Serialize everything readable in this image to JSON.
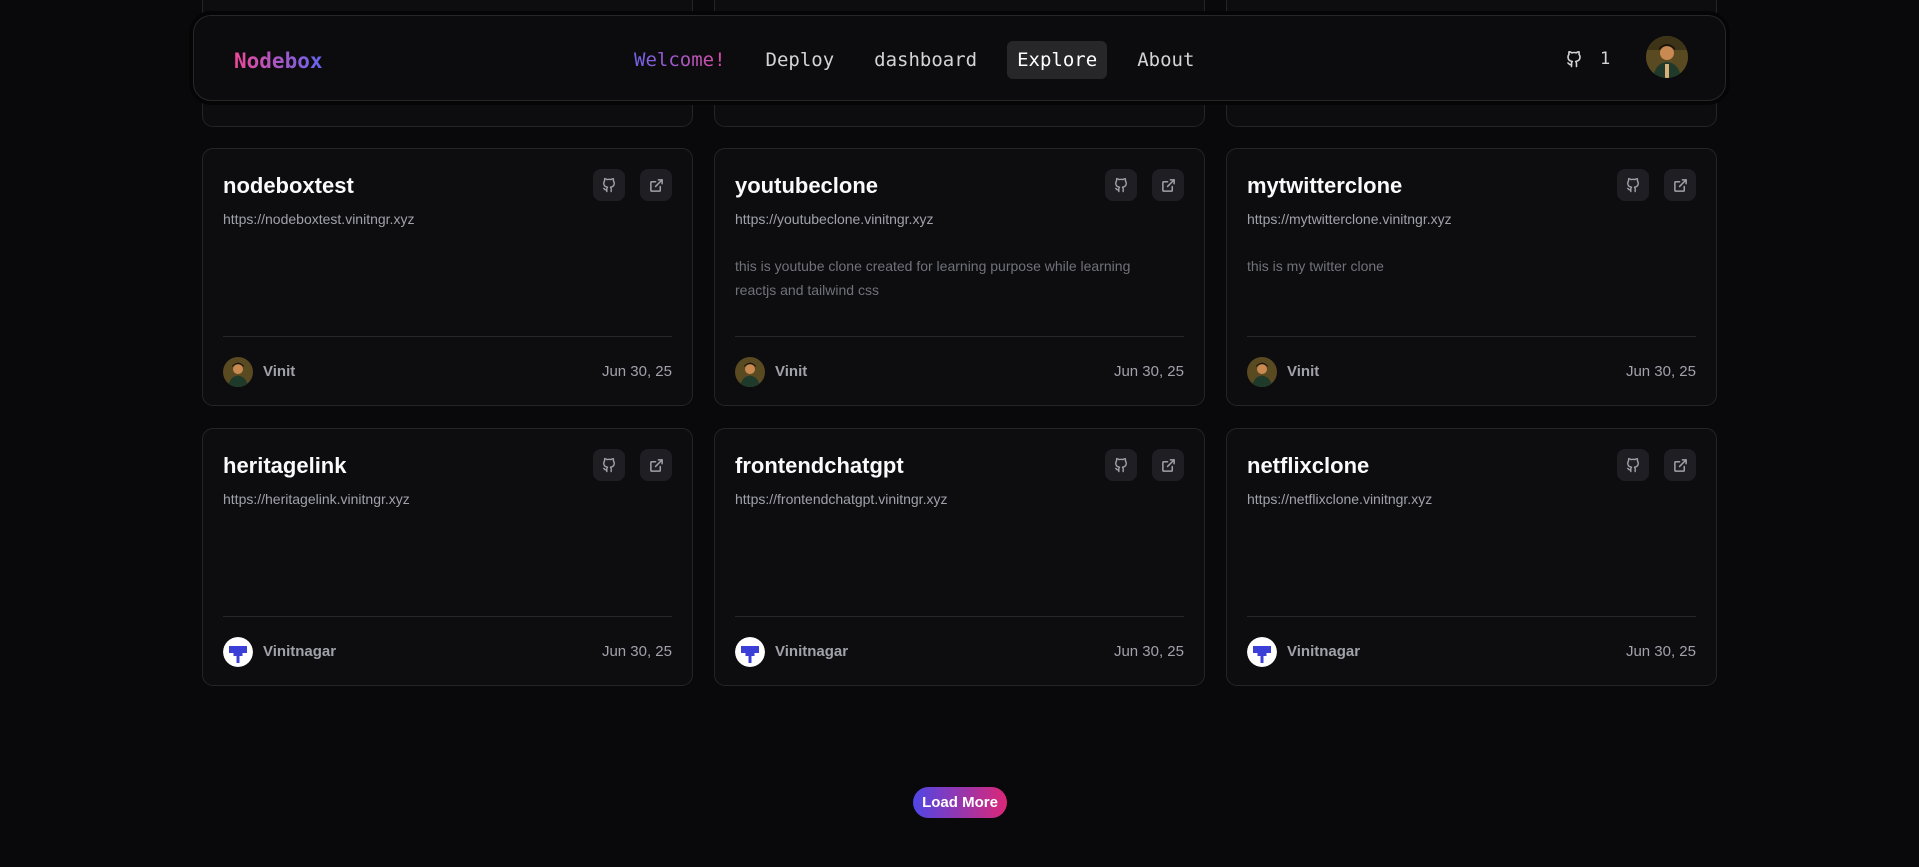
{
  "header": {
    "brand": "Nodebox",
    "nav": {
      "welcome": "Welcome!",
      "deploy": "Deploy",
      "dashboard": "dashboard",
      "explore": "Explore",
      "about": "About"
    },
    "github_count": "1"
  },
  "projects": [
    {
      "name": "nodeboxtest",
      "url": "https://nodeboxtest.vinitngr.xyz",
      "description": "",
      "author": "Vinit",
      "date": "Jun 30, 25"
    },
    {
      "name": "youtubeclone",
      "url": "https://youtubeclone.vinitngr.xyz",
      "description": "this is youtube clone created for learning purpose while learning reactjs and tailwind css",
      "author": "Vinit",
      "date": "Jun 30, 25"
    },
    {
      "name": "mytwitterclone",
      "url": "https://mytwitterclone.vinitngr.xyz",
      "description": "this is my twitter clone",
      "author": "Vinit",
      "date": "Jun 30, 25"
    },
    {
      "name": "heritagelink",
      "url": "https://heritagelink.vinitngr.xyz",
      "description": "",
      "author": "Vinitnagar",
      "date": "Jun 30, 25"
    },
    {
      "name": "frontendchatgpt",
      "url": "https://frontendchatgpt.vinitngr.xyz",
      "description": "",
      "author": "Vinitnagar",
      "date": "Jun 30, 25"
    },
    {
      "name": "netflixclone",
      "url": "https://netflixclone.vinitngr.xyz",
      "description": "",
      "author": "Vinitnagar",
      "date": "Jun 30, 25"
    }
  ],
  "load_more_label": "Load More",
  "icons": {
    "github": "github-icon",
    "external": "external-link-icon",
    "avatar_photo": "user-photo-avatar",
    "avatar_logo": "default-logo-avatar"
  },
  "colors": {
    "background": "#09090b",
    "card": "#0d0d10",
    "accent_start": "#6366f1",
    "accent_end": "#ec4899"
  }
}
